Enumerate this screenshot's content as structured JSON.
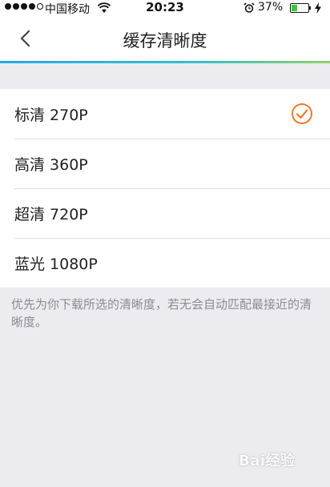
{
  "status_bar": {
    "carrier": "中国移动",
    "time": "20:23",
    "battery_percent": "37%",
    "battery_level": 0.37,
    "signal_bars_filled": 4,
    "signal_bars_total": 5,
    "battery_color": "#3cc63c"
  },
  "nav": {
    "title": "缓存清晰度",
    "back_icon": "chevron-left-icon"
  },
  "options": [
    {
      "label": "标清 270P",
      "selected": true
    },
    {
      "label": "高清 360P",
      "selected": false
    },
    {
      "label": "超清 720P",
      "selected": false
    },
    {
      "label": "蓝光 1080P",
      "selected": false
    }
  ],
  "hint": "优先为你下载所选的清晰度，若无会自动匹配最接近的清晰度。",
  "watermark": {
    "text": "Bai经验"
  },
  "colors": {
    "accent_check": "#f07a2a",
    "nav_accent_start": "#23a9e8",
    "nav_accent_end": "#8fd06b",
    "background": "#ebebf0",
    "hint_text": "#8c8c92"
  }
}
